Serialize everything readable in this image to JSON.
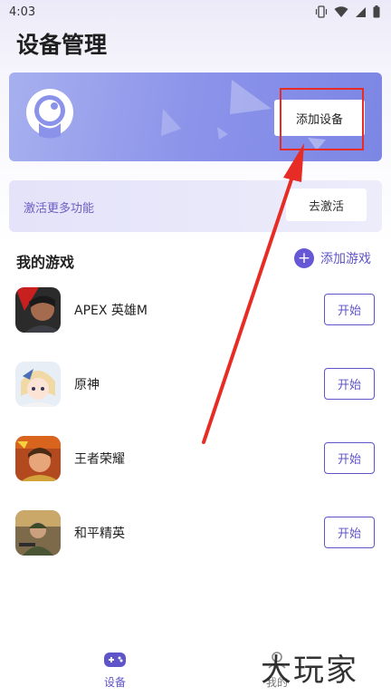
{
  "status_bar": {
    "time": "4:03"
  },
  "page": {
    "title": "设备管理"
  },
  "hero": {
    "add_device_label": "添加设备"
  },
  "activate": {
    "text": "激活更多功能",
    "button_label": "去激活"
  },
  "games_section": {
    "title": "我的游戏",
    "add_game_label": "添加游戏",
    "games": [
      {
        "name": "APEX 英雄M",
        "action": "开始"
      },
      {
        "name": "原神",
        "action": "开始"
      },
      {
        "name": "王者荣耀",
        "action": "开始"
      },
      {
        "name": "和平精英",
        "action": "开始"
      }
    ]
  },
  "nav": {
    "devices_label": "设备",
    "mine_label": "我的"
  },
  "watermark": "大玩家",
  "colors": {
    "accent": "#5f55c9",
    "hero_start": "#a7b0ee",
    "hero_end": "#7c86e4",
    "annotation": "#e62c24"
  }
}
